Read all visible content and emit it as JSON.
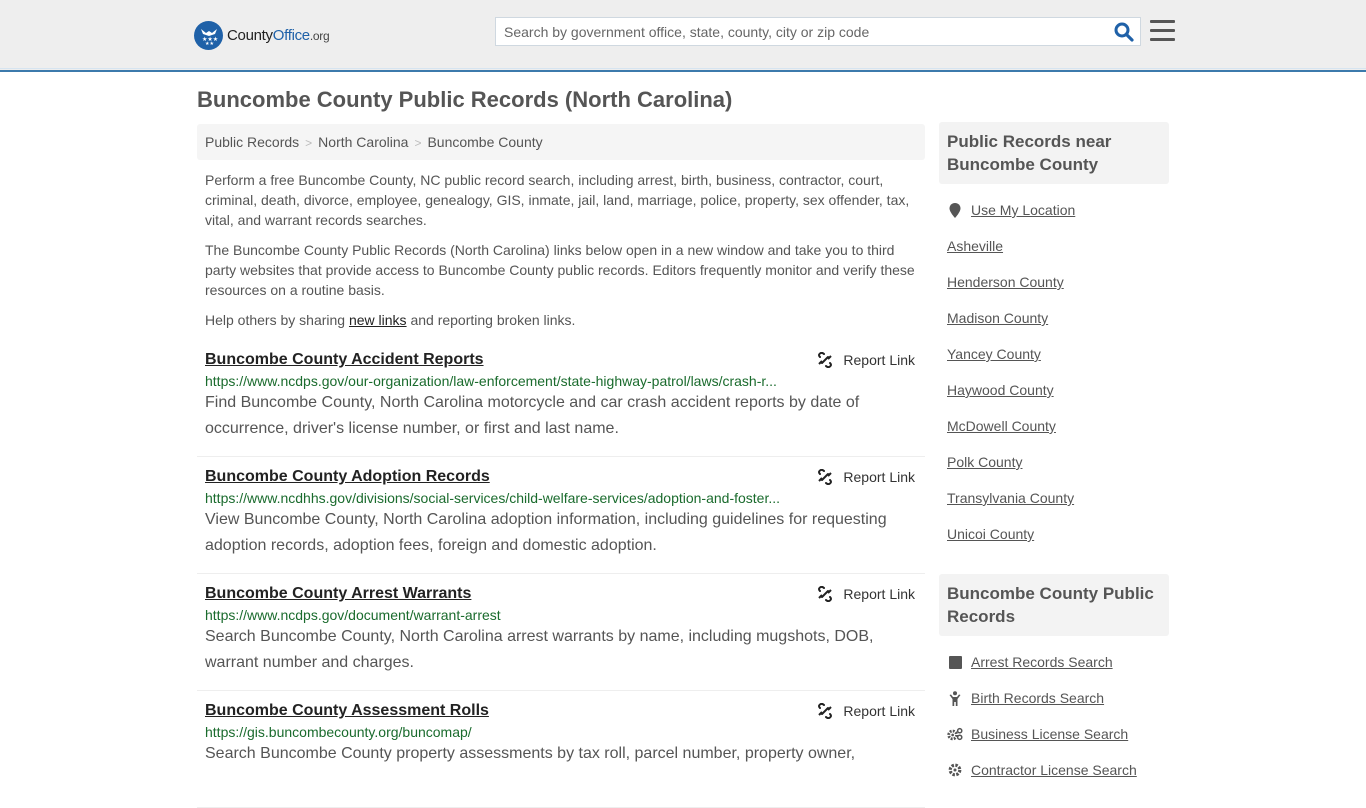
{
  "header": {
    "logo": {
      "part1": "County",
      "part2": "Office",
      "part3": ".org"
    },
    "search": {
      "placeholder": "Search by government office, state, county, city or zip code",
      "value": ""
    },
    "icons": {
      "search": "search-icon",
      "menu": "hamburger-menu-icon"
    }
  },
  "page": {
    "title": "Buncombe County Public Records (North Carolina)",
    "breadcrumb": [
      "Public Records",
      "North Carolina",
      "Buncombe County"
    ],
    "breadcrumb_separator": ">",
    "intro": {
      "p1": "Perform a free Buncombe County, NC public record search, including arrest, birth, business, contractor, court, criminal, death, divorce, employee, genealogy, GIS, inmate, jail, land, marriage, police, property, sex offender, tax, vital, and warrant records searches.",
      "p2": "The Buncombe County Public Records (North Carolina) links below open in a new window and take you to third party websites that provide access to Buncombe County public records. Editors frequently monitor and verify these resources on a routine basis.",
      "p3_before": "Help others by sharing ",
      "p3_link": "new links",
      "p3_after": " and reporting broken links."
    }
  },
  "records": [
    {
      "title": "Buncombe County Accident Reports",
      "url": "https://www.ncdps.gov/our-organization/law-enforcement/state-highway-patrol/laws/crash-r...",
      "description": "Find Buncombe County, North Carolina motorcycle and car crash accident reports by date of occurrence, driver's license number, or first and last name.",
      "report_label": "Report Link"
    },
    {
      "title": "Buncombe County Adoption Records",
      "url": "https://www.ncdhhs.gov/divisions/social-services/child-welfare-services/adoption-and-foster...",
      "description": "View Buncombe County, North Carolina adoption information, including guidelines for requesting adoption records, adoption fees, foreign and domestic adoption.",
      "report_label": "Report Link"
    },
    {
      "title": "Buncombe County Arrest Warrants",
      "url": "https://www.ncdps.gov/document/warrant-arrest",
      "description": "Search Buncombe County, North Carolina arrest warrants by name, including mugshots, DOB, warrant number and charges.",
      "report_label": "Report Link"
    },
    {
      "title": "Buncombe County Assessment Rolls",
      "url": "https://gis.buncombecounty.org/buncomap/",
      "description": "Search Buncombe County property assessments by tax roll, parcel number, property owner,",
      "report_label": "Report Link"
    }
  ],
  "sidebar": {
    "nearby": {
      "heading": "Public Records near Buncombe County",
      "use_location": "Use My Location",
      "items": [
        "Asheville",
        "Henderson County",
        "Madison County",
        "Yancey County",
        "Haywood County",
        "McDowell County",
        "Polk County",
        "Transylvania County",
        "Unicoi County"
      ]
    },
    "county_records": {
      "heading": "Buncombe County Public Records",
      "items": [
        {
          "label": "Arrest Records Search",
          "icon": "square-icon"
        },
        {
          "label": "Birth Records Search",
          "icon": "child-icon"
        },
        {
          "label": "Business License Search",
          "icon": "gears-icon"
        },
        {
          "label": "Contractor License Search",
          "icon": "gear-icon"
        }
      ]
    }
  },
  "colors": {
    "brand_blue": "#1f61a8",
    "header_border": "#3c7aac",
    "url_green": "#1a6b2d",
    "text": "#555555"
  }
}
